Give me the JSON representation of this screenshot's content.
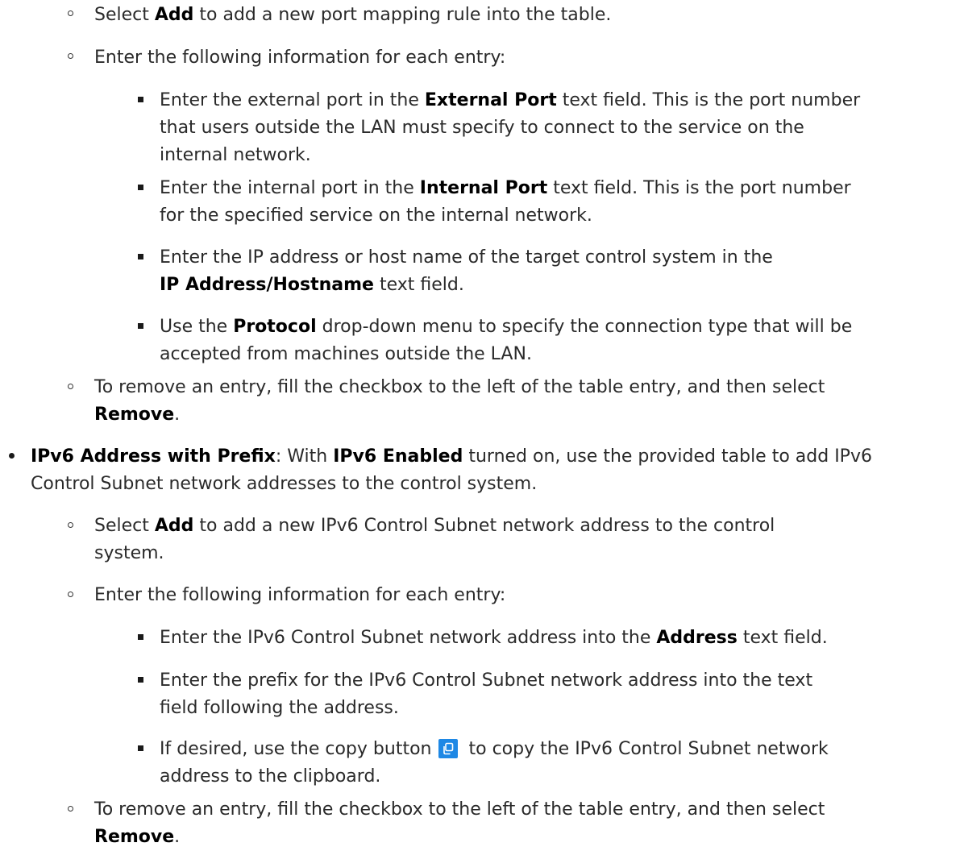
{
  "port_mapping": {
    "add_item": {
      "pre": "Select ",
      "bold": "Add",
      "post": " to add a new port mapping rule into the table."
    },
    "info_intro": "Enter the following information for each entry:",
    "external_port": {
      "pre": "Enter the external port in the ",
      "bold": "External Port",
      "post": " text field. This is the port number",
      "line2": "that users outside the LAN must specify to connect to the service on the",
      "line3": "internal network."
    },
    "internal_port": {
      "pre": "Enter the internal port in the ",
      "bold": "Internal Port",
      "post": " text field. This is the port number",
      "line2": "for the specified service on the internal network."
    },
    "ip_address": {
      "line1": "Enter the IP address or host name of the target control system in the",
      "bold": "IP Address/Hostname",
      "post": " text field."
    },
    "protocol": {
      "pre": "Use the ",
      "bold": "Protocol",
      "post": " drop-down menu to specify the connection type that will be",
      "line2": "accepted from machines outside the LAN."
    },
    "remove_item": {
      "line1": "To remove an entry, fill the checkbox to the left of the table entry, and then select",
      "bold": "Remove",
      "post": "."
    }
  },
  "ipv6": {
    "heading_bold": "IPv6 Address with Prefix",
    "heading_mid": ": With ",
    "heading_bold2": "IPv6 Enabled",
    "heading_post": " turned on, use the provided table to add IPv6",
    "heading_line2": "Control Subnet network addresses to the control system.",
    "add_item": {
      "pre": "Select ",
      "bold": "Add",
      "post": " to add a new IPv6 Control Subnet network address to the control",
      "line2": "system."
    },
    "info_intro": "Enter the following information for each entry:",
    "address": {
      "pre": "Enter the IPv6 Control Subnet network address into the ",
      "bold": "Address",
      "post": " text field."
    },
    "prefix": {
      "line1": "Enter the prefix for the IPv6 Control Subnet network address into the text",
      "line2": "field following the address."
    },
    "copy": {
      "pre": "If desired, use the copy button",
      "post": "to copy the IPv6 Control Subnet network",
      "line2": "address to the clipboard.",
      "icon": "copy-icon",
      "button_color": "#1e88e5"
    },
    "remove_item": {
      "line1": "To remove an entry, fill the checkbox to the left of the table entry, and then select",
      "bold": "Remove",
      "post": "."
    }
  }
}
